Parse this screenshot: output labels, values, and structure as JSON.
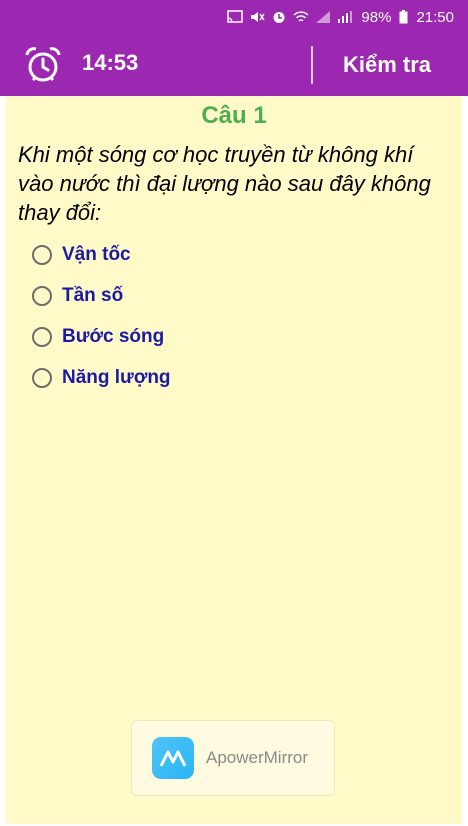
{
  "status_bar": {
    "battery": "98%",
    "time": "21:50",
    "icons": [
      "cast-icon",
      "mute-icon",
      "alarm-status-icon",
      "wifi-icon",
      "signal-icon",
      "signal-icon",
      "battery-icon"
    ]
  },
  "app_bar": {
    "timer": "14:53",
    "check_label": "Kiểm tra",
    "alarm_icon": "alarm-clock-icon"
  },
  "question": {
    "title": "Câu 1",
    "text": "Khi một sóng cơ học truyền từ không khí vào nước thì đại lượng nào sau đây không thay đổi:",
    "options": [
      "Vận tốc",
      "Tần số",
      "Bước sóng",
      "Năng lượng"
    ]
  },
  "watermark": {
    "label": "ApowerMirror"
  },
  "colors": {
    "primary": "#9c27b0",
    "content_bg": "#fffac8",
    "title_green": "#4caf50",
    "option_blue": "#1a1aa6"
  }
}
